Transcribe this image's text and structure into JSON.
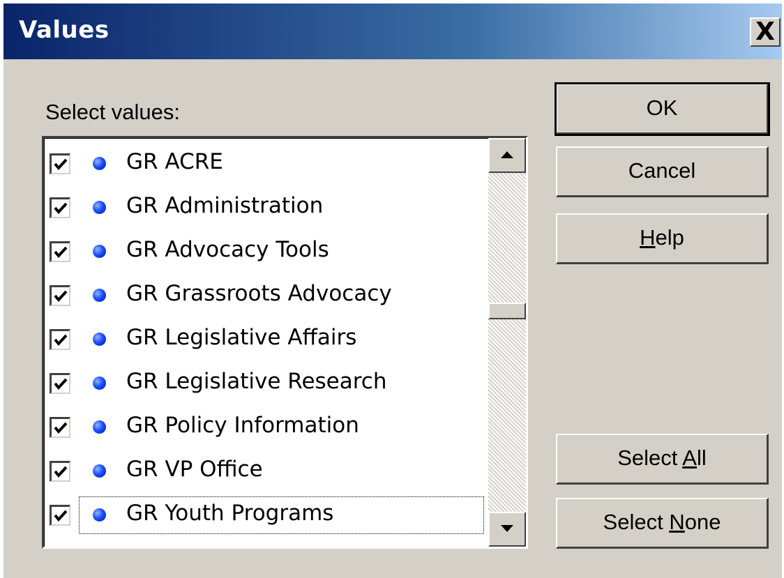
{
  "dialog": {
    "title": "Values",
    "close_label": "X"
  },
  "prompt_label": "Select values:",
  "items": [
    {
      "label": "GR ACRE",
      "checked": true
    },
    {
      "label": "GR Administration",
      "checked": true
    },
    {
      "label": "GR Advocacy Tools",
      "checked": true
    },
    {
      "label": "GR Grassroots Advocacy",
      "checked": true
    },
    {
      "label": "GR Legislative Affairs",
      "checked": true
    },
    {
      "label": "GR Legislative Research",
      "checked": true
    },
    {
      "label": "GR Policy Information",
      "checked": true
    },
    {
      "label": "GR VP Office",
      "checked": true
    },
    {
      "label": "GR Youth Programs",
      "checked": true
    }
  ],
  "focused_item": "GR Youth Programs",
  "buttons": {
    "ok": "OK",
    "cancel": "Cancel",
    "help": {
      "mnemonic": "H",
      "rest": "elp"
    },
    "select_all": {
      "pre": "Select ",
      "mnemonic": "A",
      "rest": "ll"
    },
    "select_none": {
      "pre": "Select ",
      "mnemonic": "N",
      "rest": "one"
    }
  },
  "colors": {
    "titlebar_start": "#0a246a",
    "titlebar_end": "#a6caf0",
    "dialog_face": "#d4d0c8",
    "bullet": "#1c4fff"
  },
  "icons": {
    "close": "close-icon",
    "checkbox": "checkmark-icon",
    "bullet": "blue-bullet-icon",
    "scroll_up": "scroll-up-arrow-icon",
    "scroll_down": "scroll-down-arrow-icon"
  }
}
